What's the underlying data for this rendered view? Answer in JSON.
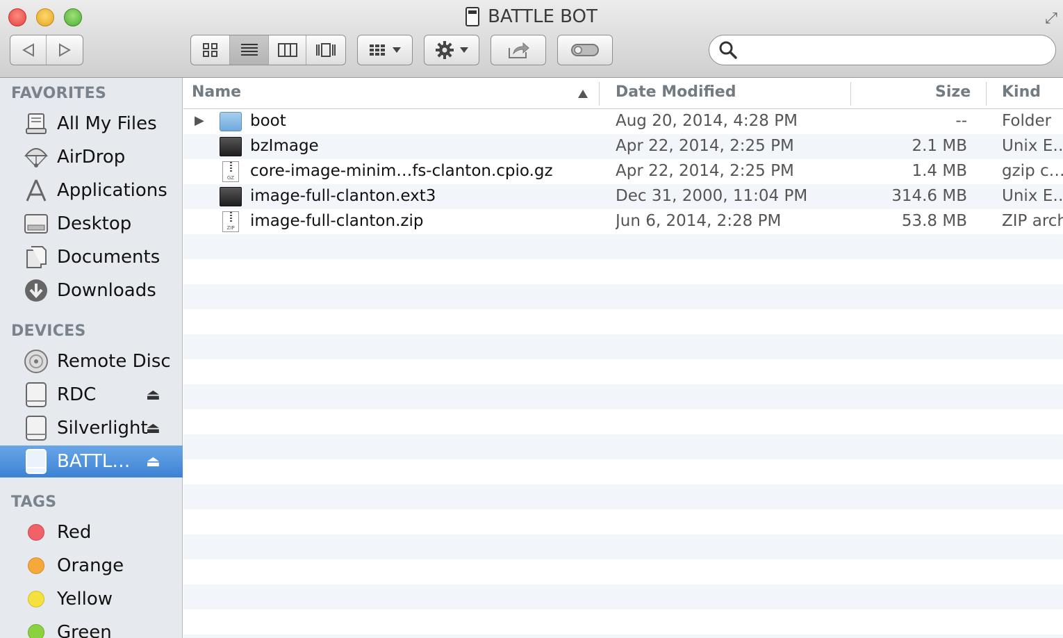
{
  "window": {
    "title": "BATTLE BOT"
  },
  "toolbar": {
    "search": {
      "value": "",
      "placeholder": ""
    }
  },
  "sidebar": {
    "favorites_header": "FAVORITES",
    "favorites": [
      {
        "label": "All My Files",
        "icon": "all-my-files-icon"
      },
      {
        "label": "AirDrop",
        "icon": "airdrop-icon"
      },
      {
        "label": "Applications",
        "icon": "applications-icon"
      },
      {
        "label": "Desktop",
        "icon": "desktop-icon"
      },
      {
        "label": "Documents",
        "icon": "documents-icon"
      },
      {
        "label": "Downloads",
        "icon": "downloads-icon"
      }
    ],
    "devices_header": "DEVICES",
    "devices": [
      {
        "label": "Remote Disc",
        "icon": "remote-disc-icon",
        "eject": false
      },
      {
        "label": "RDC",
        "icon": "drive-icon",
        "eject": true
      },
      {
        "label": "Silverlight",
        "icon": "drive-icon",
        "eject": true
      },
      {
        "label": "BATTL…",
        "icon": "drive-icon",
        "eject": true,
        "selected": true
      }
    ],
    "tags_header": "TAGS",
    "tags": [
      {
        "label": "Red",
        "color": "#f0616a"
      },
      {
        "label": "Orange",
        "color": "#f6a83b"
      },
      {
        "label": "Yellow",
        "color": "#f4e13d"
      },
      {
        "label": "Green",
        "color": "#8bd23f"
      }
    ]
  },
  "list": {
    "columns": {
      "name": "Name",
      "date": "Date Modified",
      "size": "Size",
      "kind": "Kind"
    },
    "files": [
      {
        "name": "boot",
        "date": "Aug 20, 2014, 4:28 PM",
        "size": "--",
        "kind": "Folder",
        "icon": "folder-icon"
      },
      {
        "name": "bzImage",
        "date": "Apr 22, 2014, 2:25 PM",
        "size": "2.1 MB",
        "kind": "Unix E…",
        "icon": "unix-executable-icon"
      },
      {
        "name": "core-image-minim…fs-clanton.cpio.gz",
        "date": "Apr 22, 2014, 2:25 PM",
        "size": "1.4 MB",
        "kind": "gzip c…",
        "icon": "gz-archive-icon"
      },
      {
        "name": "image-full-clanton.ext3",
        "date": "Dec 31, 2000, 11:04 PM",
        "size": "314.6 MB",
        "kind": "Unix E…",
        "icon": "unix-executable-icon"
      },
      {
        "name": "image-full-clanton.zip",
        "date": "Jun 6, 2014, 2:28 PM",
        "size": "53.8 MB",
        "kind": "ZIP arch",
        "icon": "zip-archive-icon"
      }
    ]
  }
}
